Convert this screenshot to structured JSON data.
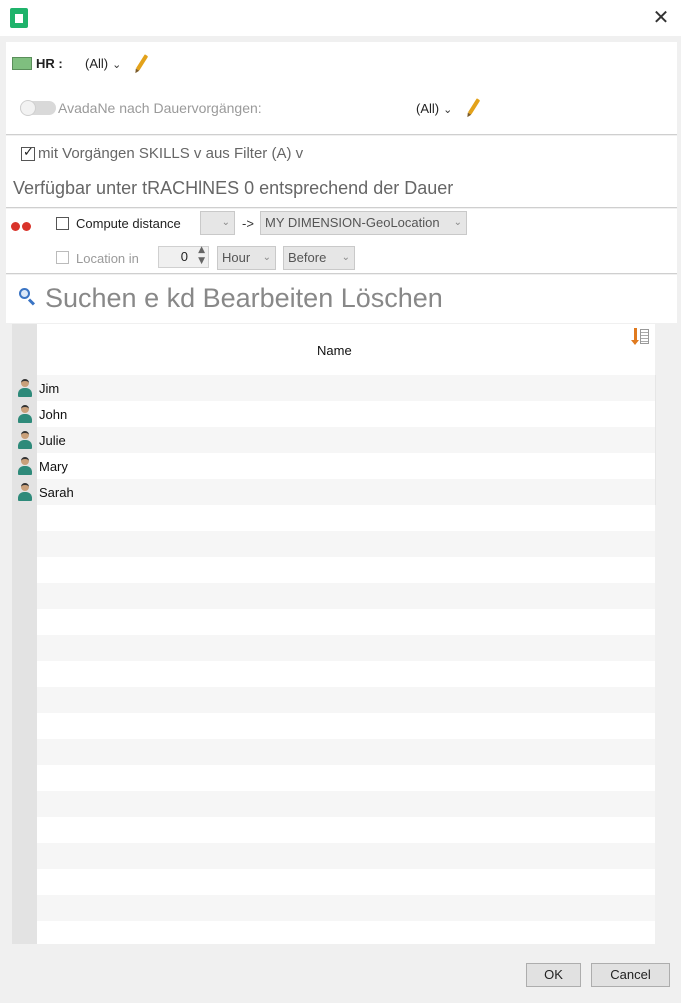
{
  "title_bar": {
    "close_glyph": "✕"
  },
  "filters": {
    "hr_label": "HR :",
    "hr_value": "(All)",
    "toggle_label": "AvadaNe nach Dauervorgängen:",
    "toggle_value": "(All)",
    "checkbox_label": "mit Vorgängen SKILLS v aus Filter (A) v",
    "available_text": "Verfügbar unter tRACHlNES 0 entsprechend der Dauer"
  },
  "distance": {
    "compute_label": "Compute distance",
    "arrow_text": "->",
    "dimension_value": "MY DIMENSION-GeoLocation",
    "location_label": "Location in",
    "location_value": "0",
    "unit_value": "Hour",
    "when_value": "Before"
  },
  "toolbar": {
    "text": "Suchen e kd Bearbeiten Löschen"
  },
  "table": {
    "header": "Name",
    "rows": [
      "Jim",
      "John",
      "Julie",
      "Mary",
      "Sarah"
    ]
  },
  "footer": {
    "ok_label": "OK",
    "cancel_label": "Cancel"
  },
  "colors": {
    "accent": "#1fb36b",
    "avatar_body": "#2e8a7a",
    "pencil": "#e3a21a"
  }
}
